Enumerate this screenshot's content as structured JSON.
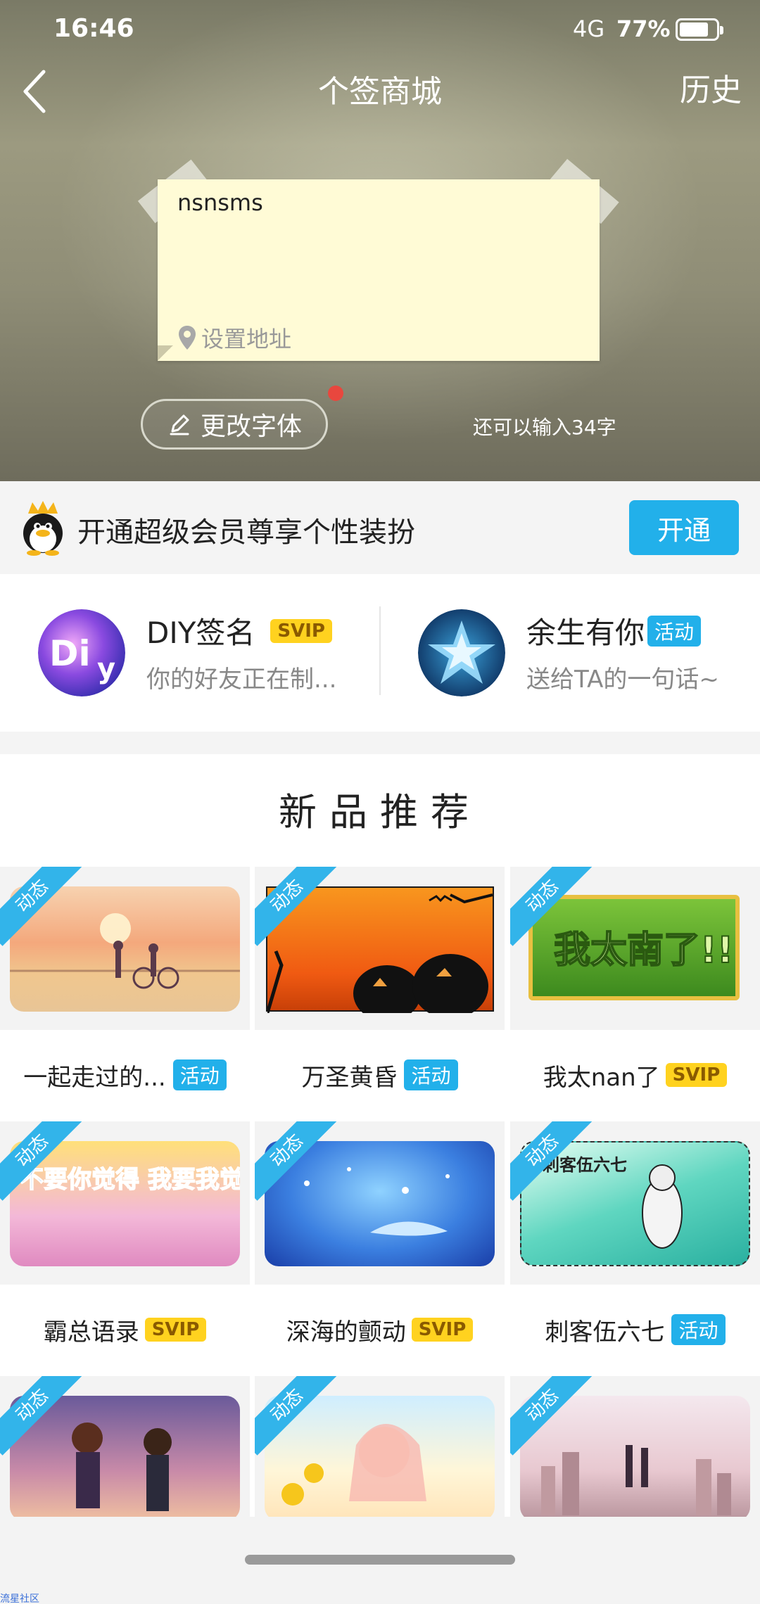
{
  "status_bar": {
    "time": "16:46",
    "network": "4G",
    "battery": "77%",
    "battery_level": 0.77
  },
  "nav": {
    "title": "个签商城",
    "history": "历史"
  },
  "note": {
    "text": "nsnsms",
    "location_placeholder": "设置地址"
  },
  "editor": {
    "font_button": "更改字体",
    "chars_left": "还可以输入34字"
  },
  "vip_banner": {
    "text": "开通超级会员尊享个性装扮",
    "button": "开通"
  },
  "features": [
    {
      "title": "DIY签名",
      "badge": "SVIP",
      "subtitle": "你的好友正在制...",
      "icon": "diy-icon"
    },
    {
      "title": "余生有你",
      "badge": "活动",
      "subtitle": "送给TA的一句话~",
      "icon": "star-icon"
    }
  ],
  "new_products": {
    "title": "新品推荐",
    "items": [
      {
        "name": "一起走过的...",
        "badge": "活动",
        "tag": "动态"
      },
      {
        "name": "万圣黄昏",
        "badge": "活动",
        "tag": "动态"
      },
      {
        "name": "我太nan了",
        "badge": "SVIP",
        "tag": "动态",
        "art_text": "我太南了!!"
      },
      {
        "name": "霸总语录",
        "badge": "SVIP",
        "tag": "动态",
        "art_text": "不要你觉得 我要我觉得"
      },
      {
        "name": "深海的颤动",
        "badge": "SVIP",
        "tag": "动态"
      },
      {
        "name": "刺客伍六七",
        "badge": "活动",
        "tag": "动态",
        "art_text": "刺客伍六七"
      },
      {
        "name": "",
        "badge": "",
        "tag": "动态"
      },
      {
        "name": "",
        "badge": "",
        "tag": "动态"
      },
      {
        "name": "",
        "badge": "",
        "tag": "动态"
      }
    ]
  },
  "watermark": "流星社区",
  "colors": {
    "accent": "#22b0ea",
    "svip": "#ffd21f",
    "note": "#fffbd6",
    "red_dot": "#e8473e"
  }
}
